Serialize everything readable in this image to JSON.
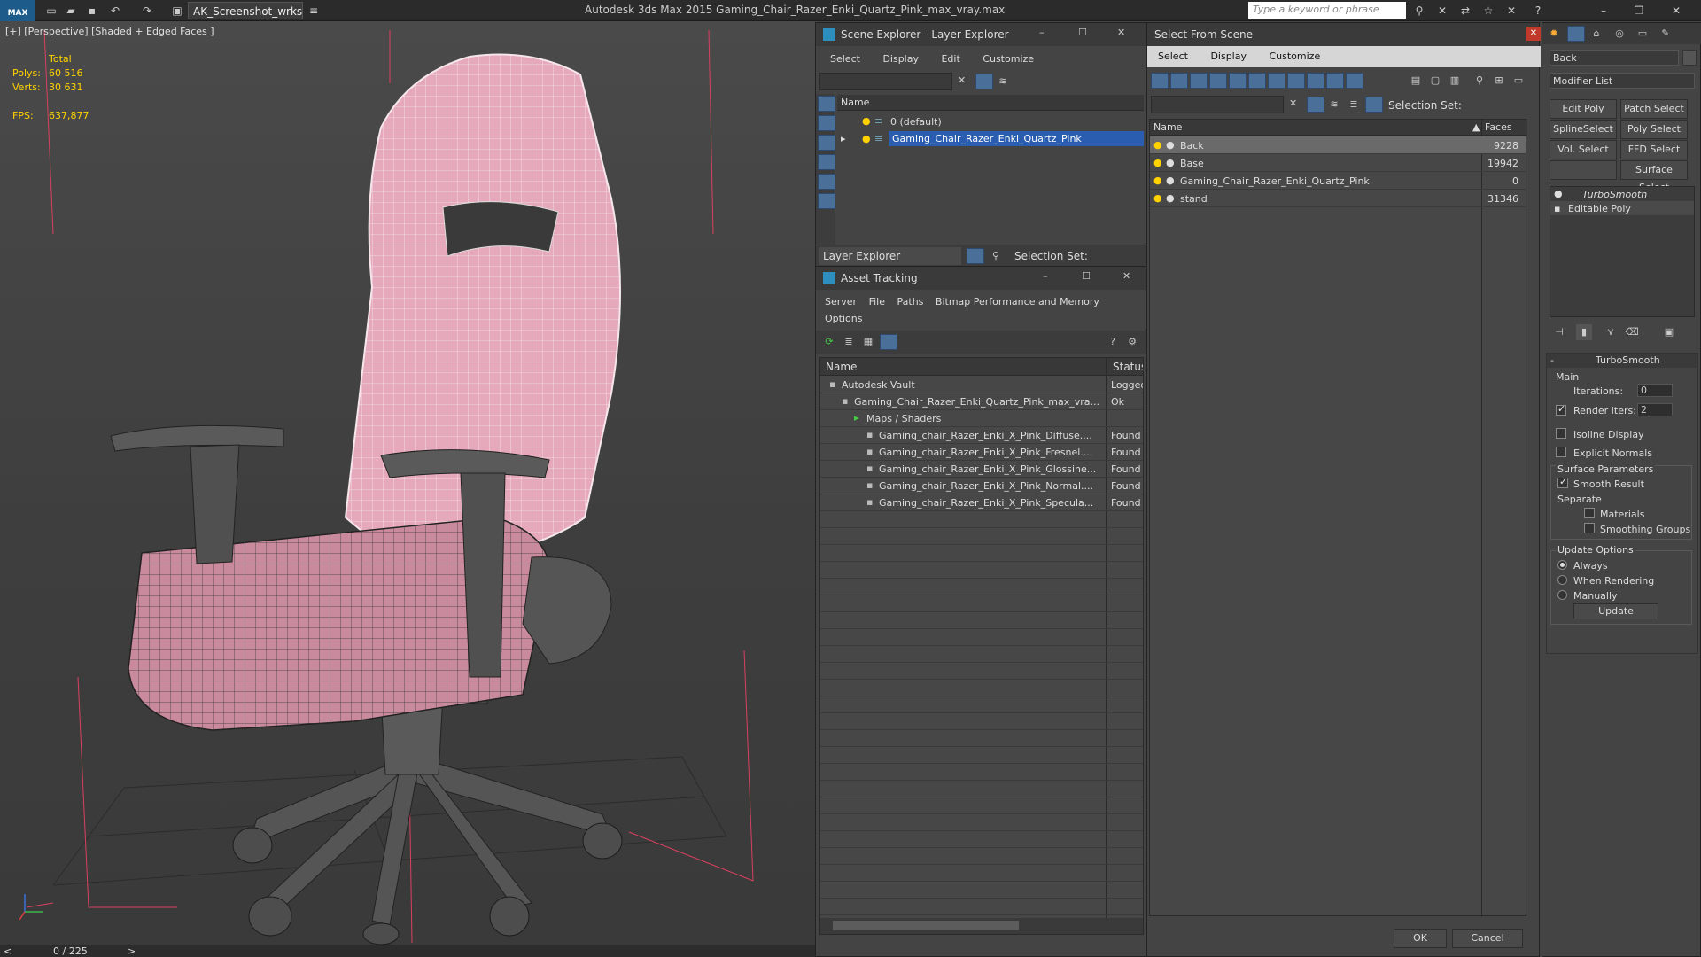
{
  "titlebar": {
    "logo": "MAX",
    "workspace": "AK_Screenshot_wrksp",
    "app_title": "Autodesk 3ds Max  2015    Gaming_Chair_Razer_Enki_Quartz_Pink_max_vray.max",
    "search_placeholder": "Type a keyword or phrase"
  },
  "viewport": {
    "label": "[+] [Perspective] [Shaded + Edged Faces ]",
    "total_label": "Total",
    "polys_label": "Polys:",
    "polys_value": "60 516",
    "verts_label": "Verts:",
    "verts_value": "30 631",
    "fps_label": "FPS:",
    "fps_value": "637,877"
  },
  "timeline": {
    "frame": "0 / 225",
    "prev": "<",
    "next": ">"
  },
  "scene_explorer": {
    "title": "Scene Explorer - Layer Explorer",
    "menu": [
      "Select",
      "Display",
      "Edit",
      "Customize"
    ],
    "col_name": "Name",
    "layers": [
      "0 (default)",
      "Gaming_Chair_Razer_Enki_Quartz_Pink"
    ],
    "footer_dropdown": "Layer Explorer",
    "selection_set": "Selection Set:"
  },
  "asset_tracking": {
    "title": "Asset Tracking",
    "menu1": [
      "Server",
      "File",
      "Paths",
      "Bitmap Performance and Memory"
    ],
    "menu2": "Options",
    "col_name": "Name",
    "col_status": "Status",
    "rows": [
      {
        "name": "Autodesk Vault",
        "status": "Logged"
      },
      {
        "name": "Gaming_Chair_Razer_Enki_Quartz_Pink_max_vra...",
        "status": "Ok"
      },
      {
        "name": "Maps / Shaders",
        "status": ""
      },
      {
        "name": "Gaming_chair_Razer_Enki_X_Pink_Diffuse....",
        "status": "Found"
      },
      {
        "name": "Gaming_chair_Razer_Enki_X_Pink_Fresnel....",
        "status": "Found"
      },
      {
        "name": "Gaming_chair_Razer_Enki_X_Pink_Glossine...",
        "status": "Found"
      },
      {
        "name": "Gaming_chair_Razer_Enki_X_Pink_Normal....",
        "status": "Found"
      },
      {
        "name": "Gaming_chair_Razer_Enki_X_Pink_Specula...",
        "status": "Found"
      }
    ]
  },
  "select_from_scene": {
    "title": "Select From Scene",
    "menu": [
      "Select",
      "Display",
      "Customize"
    ],
    "selection_set": "Selection Set:",
    "col_name": "Name",
    "col_faces": "Faces",
    "rows": [
      {
        "name": "Back",
        "faces": "9228"
      },
      {
        "name": "Base",
        "faces": "19942"
      },
      {
        "name": "Gaming_Chair_Razer_Enki_Quartz_Pink",
        "faces": "0"
      },
      {
        "name": "stand",
        "faces": "31346"
      }
    ],
    "ok": "OK",
    "cancel": "Cancel"
  },
  "command_panel": {
    "object_name": "Back",
    "modifier_list": "Modifier List",
    "buttons": [
      "Edit Poly",
      "Patch Select",
      "SplineSelect",
      "Poly Select",
      "Vol. Select",
      "FFD Select",
      "",
      "Surface Select"
    ],
    "stack": [
      "TurboSmooth",
      "Editable Poly"
    ],
    "turbosmooth": {
      "title": "TurboSmooth",
      "main": "Main",
      "iterations_label": "Iterations:",
      "iterations": "0",
      "render_iters_label": "Render Iters:",
      "render_iters": "2",
      "isoline": "Isoline Display",
      "explicit": "Explicit Normals",
      "surface_params": "Surface Parameters",
      "smooth_result": "Smooth Result",
      "separate": "Separate",
      "materials": "Materials",
      "smoothing_groups": "Smoothing Groups",
      "update_options": "Update Options",
      "always": "Always",
      "when_rendering": "When Rendering",
      "manually": "Manually",
      "update": "Update",
      "minus": "-"
    }
  },
  "colors": {
    "accent": "#2a5db0",
    "stat": "#ffd200",
    "pink": "#d98fa6",
    "wire": "#222222"
  }
}
